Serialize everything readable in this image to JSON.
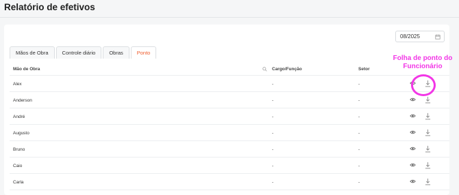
{
  "page": {
    "title": "Relatório de efetivos"
  },
  "filters": {
    "date": "08/2025",
    "calendar_icon": "calendar-icon"
  },
  "tabs": [
    {
      "label": "Mãos de Obra",
      "active": false
    },
    {
      "label": "Controle diário",
      "active": false
    },
    {
      "label": "Obras",
      "active": false
    },
    {
      "label": "Ponto",
      "active": true
    }
  ],
  "table": {
    "headers": [
      "Mão de Obra",
      "Cargo/Função",
      "Setor"
    ],
    "rows": [
      {
        "name": "Alex",
        "cargo": "-",
        "setor": "-"
      },
      {
        "name": "Anderson",
        "cargo": "-",
        "setor": "-"
      },
      {
        "name": "André",
        "cargo": "-",
        "setor": "-"
      },
      {
        "name": "Augusto",
        "cargo": "-",
        "setor": "-"
      },
      {
        "name": "Bruno",
        "cargo": "-",
        "setor": "-"
      },
      {
        "name": "Caio",
        "cargo": "-",
        "setor": "-"
      },
      {
        "name": "Carla",
        "cargo": "-",
        "setor": "-"
      }
    ]
  },
  "annotation": {
    "text": "Folha de ponto do Funcionário",
    "color": "#f236e6"
  },
  "colors": {
    "accent": "#ef5b2b",
    "annotation": "#f236e6"
  }
}
